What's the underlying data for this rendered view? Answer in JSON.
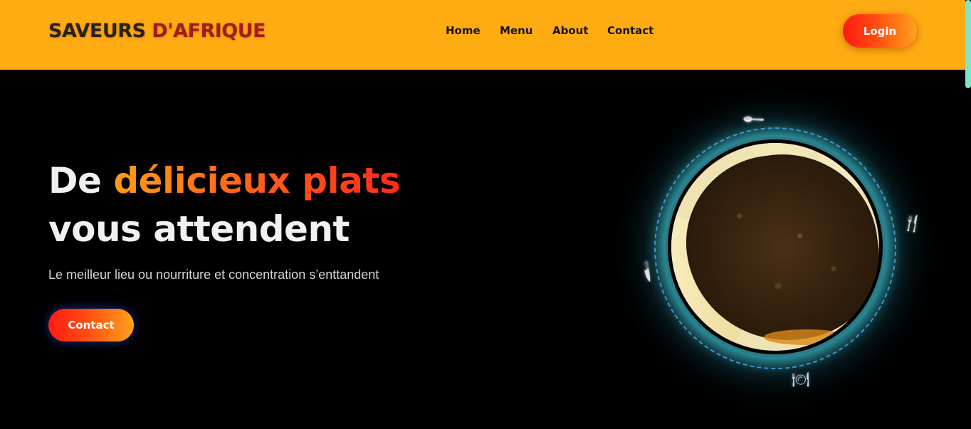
{
  "header": {
    "brand_part1": "SAVEURS",
    "brand_part2": "D'AFRIQUE",
    "nav": [
      "Home",
      "Menu",
      "About",
      "Contact"
    ],
    "login_label": "Login"
  },
  "hero": {
    "title_word1": "De",
    "title_highlight": "délicieux plats",
    "title_line2": "vous attendent",
    "subtitle": "Le meilleur lieu ou nourriture et concentration s’enttandent",
    "cta_label": "Contact"
  },
  "visual": {
    "icons": [
      "spoon-icon",
      "fork-knife-icon",
      "knife-icon",
      "plate-icon"
    ]
  },
  "colors": {
    "header_bg": "#ffab12",
    "page_bg": "#000000",
    "brand_dark": "#2b2116",
    "brand_red": "#a21c18",
    "button_gradient_start": "#ff1a12",
    "button_gradient_end": "#ffa21a",
    "glow": "#40c8d7",
    "orbit": "#3f8fd6"
  }
}
